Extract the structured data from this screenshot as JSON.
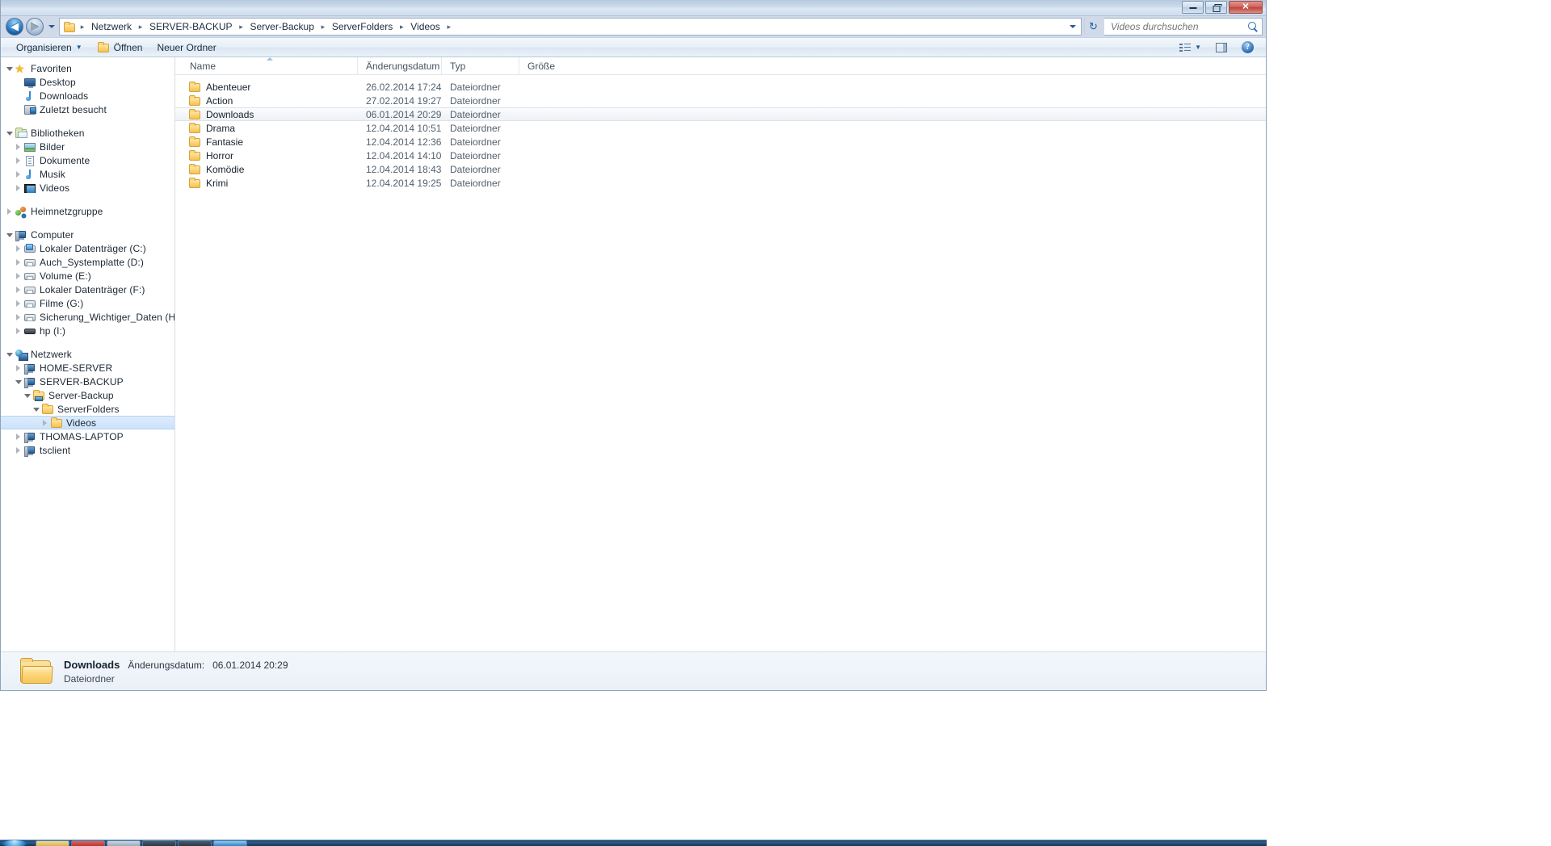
{
  "window": {
    "controls": {
      "minimize": "Minimieren",
      "restore": "Wiederherstellen",
      "close": "Schließen",
      "close_glyph": "✕"
    }
  },
  "address_bar": {
    "back_tooltip": "Zurück",
    "forward_tooltip": "Vorwärts",
    "back_glyph": "◀",
    "forward_glyph": "▶",
    "history_tooltip": "Zuletzt besuchte Seiten",
    "dropdown_glyph": "▼",
    "refresh_tooltip": "Aktualisieren",
    "refresh_glyph": "↻",
    "separator": "▸",
    "crumbs": [
      "Netzwerk",
      "SERVER-BACKUP",
      "Server-Backup",
      "ServerFolders",
      "Videos"
    ]
  },
  "search": {
    "placeholder": "Videos durchsuchen",
    "value": ""
  },
  "command_bar": {
    "organize": "Organisieren",
    "organize_caret": "▼",
    "open": "Öffnen",
    "new_folder": "Neuer Ordner",
    "view_caret": "▼",
    "help_glyph": "?"
  },
  "nav_pane": {
    "groups": [
      {
        "header": {
          "label": "Favoriten",
          "icon": "star-icon",
          "state": "expanded"
        },
        "items": [
          {
            "label": "Desktop",
            "icon": "desktop-icon",
            "twisty": "none",
            "indent": 2
          },
          {
            "label": "Downloads",
            "icon": "music-note-icon",
            "twisty": "none",
            "indent": 2
          },
          {
            "label": "Zuletzt besucht",
            "icon": "recent-places-icon",
            "twisty": "none",
            "indent": 2
          }
        ]
      },
      {
        "header": {
          "label": "Bibliotheken",
          "icon": "library-icon",
          "state": "expanded"
        },
        "items": [
          {
            "label": "Bilder",
            "icon": "pictures-icon",
            "twisty": "closed",
            "indent": 2
          },
          {
            "label": "Dokumente",
            "icon": "documents-icon",
            "twisty": "closed",
            "indent": 2
          },
          {
            "label": "Musik",
            "icon": "music-note-icon",
            "twisty": "closed",
            "indent": 2
          },
          {
            "label": "Videos",
            "icon": "video-icon",
            "twisty": "closed",
            "indent": 2
          }
        ]
      },
      {
        "header": {
          "label": "Heimnetzgruppe",
          "icon": "homegroup-icon",
          "state": "closed"
        },
        "items": []
      },
      {
        "header": {
          "label": "Computer",
          "icon": "computer-icon",
          "state": "expanded"
        },
        "items": [
          {
            "label": "Lokaler Datenträger (C:)",
            "icon": "system-drive-icon",
            "twisty": "closed",
            "indent": 2
          },
          {
            "label": "Auch_Systemplatte (D:)",
            "icon": "drive-icon",
            "twisty": "closed",
            "indent": 2
          },
          {
            "label": "Volume (E:)",
            "icon": "drive-icon",
            "twisty": "closed",
            "indent": 2
          },
          {
            "label": "Lokaler Datenträger (F:)",
            "icon": "drive-icon",
            "twisty": "closed",
            "indent": 2
          },
          {
            "label": "Filme (G:)",
            "icon": "drive-icon",
            "twisty": "closed",
            "indent": 2
          },
          {
            "label": "Sicherung_Wichtiger_Daten (H:)",
            "icon": "drive-icon",
            "twisty": "closed",
            "indent": 2
          },
          {
            "label": "hp (I:)",
            "icon": "optical-drive-icon",
            "twisty": "closed",
            "indent": 2
          }
        ]
      },
      {
        "header": {
          "label": "Netzwerk",
          "icon": "network-icon",
          "state": "expanded"
        },
        "items": [
          {
            "label": "HOME-SERVER",
            "icon": "network-computer-icon",
            "twisty": "closed",
            "indent": 2
          },
          {
            "label": "SERVER-BACKUP",
            "icon": "network-computer-icon",
            "twisty": "open",
            "indent": 2
          },
          {
            "label": "Server-Backup",
            "icon": "network-share-icon",
            "twisty": "open",
            "indent": 3
          },
          {
            "label": "ServerFolders",
            "icon": "folder-icon",
            "twisty": "open",
            "indent": 4
          },
          {
            "label": "Videos",
            "icon": "folder-icon",
            "twisty": "closed",
            "indent": 5,
            "selected": true
          },
          {
            "label": "THOMAS-LAPTOP",
            "icon": "network-computer-icon",
            "twisty": "closed",
            "indent": 2
          },
          {
            "label": "tsclient",
            "icon": "network-computer-icon",
            "twisty": "closed",
            "indent": 2
          }
        ]
      }
    ]
  },
  "file_list": {
    "columns": [
      {
        "key": "name",
        "label": "Name",
        "sorted": true,
        "sort_dir": "asc"
      },
      {
        "key": "date",
        "label": "Änderungsdatum",
        "sorted": false
      },
      {
        "key": "type",
        "label": "Typ",
        "sorted": false
      },
      {
        "key": "size",
        "label": "Größe",
        "sorted": false
      }
    ],
    "rows": [
      {
        "name": "Abenteuer",
        "date": "26.02.2014 17:24",
        "type": "Dateiordner",
        "size": "",
        "selected": false
      },
      {
        "name": "Action",
        "date": "27.02.2014 19:27",
        "type": "Dateiordner",
        "size": "",
        "selected": false
      },
      {
        "name": "Downloads",
        "date": "06.01.2014 20:29",
        "type": "Dateiordner",
        "size": "",
        "selected": true
      },
      {
        "name": "Drama",
        "date": "12.04.2014 10:51",
        "type": "Dateiordner",
        "size": "",
        "selected": false
      },
      {
        "name": "Fantasie",
        "date": "12.04.2014 12:36",
        "type": "Dateiordner",
        "size": "",
        "selected": false
      },
      {
        "name": "Horror",
        "date": "12.04.2014 14:10",
        "type": "Dateiordner",
        "size": "",
        "selected": false
      },
      {
        "name": "Komödie",
        "date": "12.04.2014 18:43",
        "type": "Dateiordner",
        "size": "",
        "selected": false
      },
      {
        "name": "Krimi",
        "date": "12.04.2014 19:25",
        "type": "Dateiordner",
        "size": "",
        "selected": false
      }
    ]
  },
  "details_pane": {
    "name": "Downloads",
    "date_label": "Änderungsdatum:",
    "date_value": "06.01.2014 20:29",
    "type": "Dateiordner"
  },
  "colors": {
    "selection_blue": "#cde3fb",
    "folder_yellow": "#fcd77a",
    "accent": "#2f6da6",
    "close_red": "#cf6159"
  }
}
